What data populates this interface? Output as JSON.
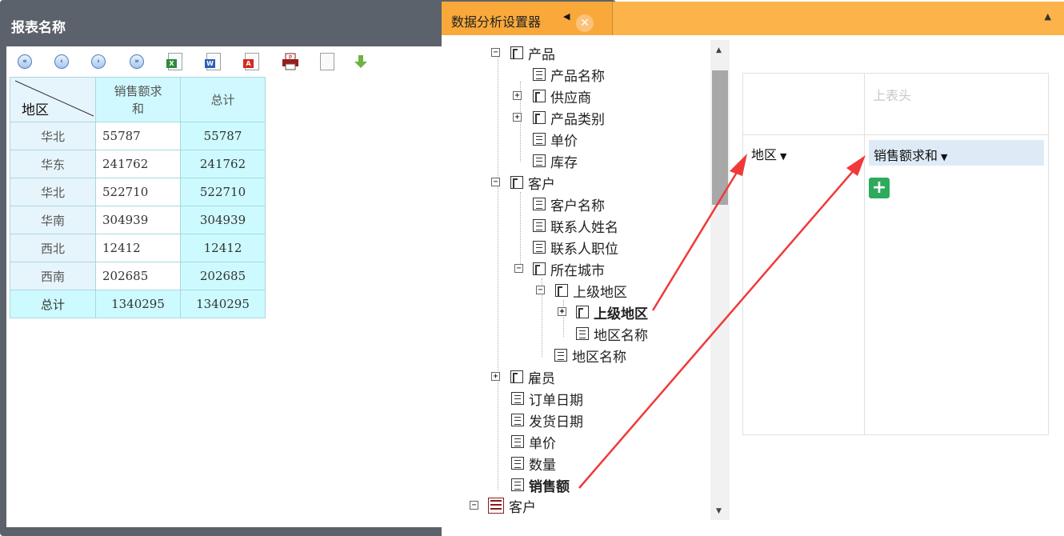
{
  "report": {
    "title": "报表名称",
    "table": {
      "corner_label": "地区",
      "headers": [
        "销售额求\n和",
        "总计"
      ],
      "rows": [
        {
          "region": "华北",
          "sales": "55787",
          "total": "55787"
        },
        {
          "region": "华东",
          "sales": "241762",
          "total": "241762"
        },
        {
          "region": "华北",
          "sales": "522710",
          "total": "522710"
        },
        {
          "region": "华南",
          "sales": "304939",
          "total": "304939"
        },
        {
          "region": "西北",
          "sales": "12412",
          "total": "12412"
        },
        {
          "region": "西南",
          "sales": "202685",
          "total": "202685"
        }
      ],
      "total_row": {
        "label": "总计",
        "sales": "1340295",
        "total": "1340295"
      }
    }
  },
  "analysis": {
    "title": "数据分析设置器",
    "tree": [
      {
        "label": "产品",
        "type": "folder",
        "expander": "−"
      },
      {
        "label": "产品名称",
        "type": "field"
      },
      {
        "label": "供应商",
        "type": "folder",
        "expander": "+"
      },
      {
        "label": "产品类别",
        "type": "folder",
        "expander": "+"
      },
      {
        "label": "单价",
        "type": "field"
      },
      {
        "label": "库存",
        "type": "field"
      },
      {
        "label": "客户",
        "type": "folder",
        "expander": "−"
      },
      {
        "label": "客户名称",
        "type": "field"
      },
      {
        "label": "联系人姓名",
        "type": "field"
      },
      {
        "label": "联系人职位",
        "type": "field"
      },
      {
        "label": "所在城市",
        "type": "folder",
        "expander": "−"
      },
      {
        "label": "上级地区",
        "type": "folder",
        "expander": "−"
      },
      {
        "label": "上级地区",
        "type": "folder",
        "expander": "+",
        "bold": true
      },
      {
        "label": "地区名称",
        "type": "field"
      },
      {
        "label": "地区名称",
        "type": "field"
      },
      {
        "label": "雇员",
        "type": "folder",
        "expander": "+"
      },
      {
        "label": "订单日期",
        "type": "field"
      },
      {
        "label": "发货日期",
        "type": "field"
      },
      {
        "label": "单价",
        "type": "field"
      },
      {
        "label": "数量",
        "type": "field"
      },
      {
        "label": "销售额",
        "type": "field",
        "bold": true
      },
      {
        "label": "客户",
        "type": "table",
        "expander": "−"
      }
    ],
    "pivot": {
      "column_placeholder": "上表头",
      "row_field": "地区",
      "value_field": "销售额求和"
    }
  },
  "colors": {
    "header_orange": "#fbb34a",
    "window_gray": "#5c626c",
    "table_header": "#cff9ff",
    "arrow_red": "#f03a3a",
    "add_green": "#2eaa5c"
  }
}
